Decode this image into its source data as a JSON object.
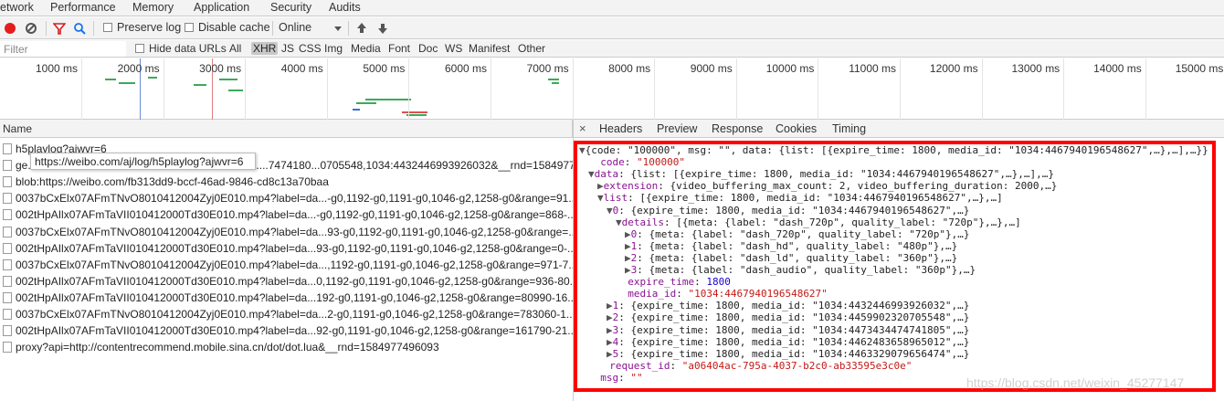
{
  "tabs": [
    "etwork",
    "Performance",
    "Memory",
    "Application",
    "Security",
    "Audits"
  ],
  "toolbar": {
    "preserve_log": "Preserve log",
    "disable_cache": "Disable cache",
    "throttle": "Online"
  },
  "filterbar": {
    "placeholder": "Filter",
    "hide_data_urls": "Hide data URLs",
    "types": [
      "All",
      "XHR",
      "JS",
      "CSS",
      "Img",
      "Media",
      "Font",
      "Doc",
      "WS",
      "Manifest",
      "Other"
    ],
    "active_type": "XHR"
  },
  "timeline": {
    "ticks": [
      "1000 ms",
      "2000 ms",
      "3000 ms",
      "4000 ms",
      "5000 ms",
      "6000 ms",
      "7000 ms",
      "8000 ms",
      "9000 ms",
      "10000 ms",
      "11000 ms",
      "12000 ms",
      "13000 ms",
      "14000 ms",
      "15000 ms"
    ]
  },
  "list": {
    "header": "Name",
    "rows": [
      "h5playlog?ajwvr=6",
      "ge...............................................................................7474180...0705548,1034:4432446993926032&__rnd=15849774...",
      "blob:https://weibo.com/fb313dd9-bccf-46ad-9846-cd8c13a70baa",
      "0037bCxElx07AFmTNvO8010412004Zyj0E010.mp4?label=da...-g0,1192-g0,1191-g0,1046-g2,1258-g0&range=91...",
      "002tHpAIlx07AFmTaVII010412000Td30E010.mp4?label=da...-g0,1192-g0,1191-g0,1046-g2,1258-g0&range=868-...",
      "0037bCxElx07AFmTNvO8010412004Zyj0E010.mp4?label=da...93-g0,1192-g0,1191-g0,1046-g2,1258-g0&range=...",
      "002tHpAIlx07AFmTaVII010412000Td30E010.mp4?label=da...93-g0,1192-g0,1191-g0,1046-g2,1258-g0&range=0-...",
      "0037bCxElx07AFmTNvO8010412004Zyj0E010.mp4?label=da...,1192-g0,1191-g0,1046-g2,1258-g0&range=971-7...",
      "002tHpAIlx07AFmTaVII010412000Td30E010.mp4?label=da...0,1192-g0,1191-g0,1046-g2,1258-g0&range=936-80...",
      "002tHpAIlx07AFmTaVII010412000Td30E010.mp4?label=da...192-g0,1191-g0,1046-g2,1258-g0&range=80990-16...",
      "0037bCxElx07AFmTNvO8010412004Zyj0E010.mp4?label=da...2-g0,1191-g0,1046-g2,1258-g0&range=783060-1...",
      "002tHpAIlx07AFmTaVII010412000Td30E010.mp4?label=da...92-g0,1191-g0,1046-g2,1258-g0&range=161790-21...",
      "proxy?api=http://contentrecommend.mobile.sina.cn/dot/dot.lua&__rnd=1584977496093"
    ],
    "tooltip": "https://weibo.com/aj/log/h5playlog?ajwvr=6"
  },
  "detail": {
    "close": "×",
    "tabs": [
      "Headers",
      "Preview",
      "Response",
      "Cookies",
      "Timing"
    ],
    "active_tab": "Preview",
    "lines": [
      {
        "indent": 0,
        "tri": "▼",
        "text": "{code: \"100000\", msg: \"\", data: {list: [{expire_time: 1800, media_id: \"1034:4467940196548627\",…},…],…}}"
      },
      {
        "indent": 1,
        "tri": "",
        "key": "code",
        "sep": ": ",
        "val": "\"100000\"",
        "cls": "s"
      },
      {
        "indent": 1,
        "tri": "▼",
        "key": "data",
        "sep": ": ",
        "val": "{list: [{expire_time: 1800, media_id: \"1034:4467940196548627\",…},…],…}",
        "cls": ""
      },
      {
        "indent": 2,
        "tri": "▶",
        "key": "extension",
        "sep": ": ",
        "val": "{video_buffering_max_count: 2, video_buffering_duration: 2000,…}",
        "cls": ""
      },
      {
        "indent": 2,
        "tri": "▼",
        "key": "list",
        "sep": ": ",
        "val": "[{expire_time: 1800, media_id: \"1034:4467940196548627\",…},…]",
        "cls": ""
      },
      {
        "indent": 3,
        "tri": "▼",
        "key": "0",
        "sep": ": ",
        "val": "{expire_time: 1800, media_id: \"1034:4467940196548627\",…}",
        "cls": ""
      },
      {
        "indent": 4,
        "tri": "▼",
        "key": "details",
        "sep": ": ",
        "val": "[{meta: {label: \"dash_720p\", quality_label: \"720p\"},…},…]",
        "cls": ""
      },
      {
        "indent": 5,
        "tri": "▶",
        "key": "0",
        "sep": ": ",
        "val": "{meta: {label: \"dash_720p\", quality_label: \"720p\"},…}",
        "cls": ""
      },
      {
        "indent": 5,
        "tri": "▶",
        "key": "1",
        "sep": ": ",
        "val": "{meta: {label: \"dash_hd\", quality_label: \"480p\"},…}",
        "cls": ""
      },
      {
        "indent": 5,
        "tri": "▶",
        "key": "2",
        "sep": ": ",
        "val": "{meta: {label: \"dash_ld\", quality_label: \"360p\"},…}",
        "cls": ""
      },
      {
        "indent": 5,
        "tri": "▶",
        "key": "3",
        "sep": ": ",
        "val": "{meta: {label: \"dash_audio\", quality_label: \"360p\"},…}",
        "cls": ""
      },
      {
        "indent": 4,
        "tri": "",
        "key": "expire_time",
        "sep": ": ",
        "val": "1800",
        "cls": "n"
      },
      {
        "indent": 4,
        "tri": "",
        "key": "media_id",
        "sep": ": ",
        "val": "\"1034:4467940196548627\"",
        "cls": "s"
      },
      {
        "indent": 3,
        "tri": "▶",
        "key": "1",
        "sep": ": ",
        "val": "{expire_time: 1800, media_id: \"1034:4432446993926032\",…}",
        "cls": ""
      },
      {
        "indent": 3,
        "tri": "▶",
        "key": "2",
        "sep": ": ",
        "val": "{expire_time: 1800, media_id: \"1034:4459902320705548\",…}",
        "cls": ""
      },
      {
        "indent": 3,
        "tri": "▶",
        "key": "3",
        "sep": ": ",
        "val": "{expire_time: 1800, media_id: \"1034:4473434474741805\",…}",
        "cls": ""
      },
      {
        "indent": 3,
        "tri": "▶",
        "key": "4",
        "sep": ": ",
        "val": "{expire_time: 1800, media_id: \"1034:4462483658965012\",…}",
        "cls": ""
      },
      {
        "indent": 3,
        "tri": "▶",
        "key": "5",
        "sep": ": ",
        "val": "{expire_time: 1800, media_id: \"1034:4463329079656474\",…}",
        "cls": ""
      },
      {
        "indent": 2,
        "tri": "",
        "key": "request_id",
        "sep": ": ",
        "val": "\"a06404ac-795a-4037-b2c0-ab33595e3c0e\"",
        "cls": "s"
      },
      {
        "indent": 1,
        "tri": "",
        "key": "msg",
        "sep": ": ",
        "val": "\"\"",
        "cls": "s"
      }
    ]
  },
  "watermark": "https://blog.csdn.net/weixin_45277147",
  "colors": {
    "highlight_border": "#ff0000",
    "record": "#e31d1d",
    "json_key": "#881391",
    "json_string": "#c41a16",
    "json_number": "#1c00cf"
  }
}
